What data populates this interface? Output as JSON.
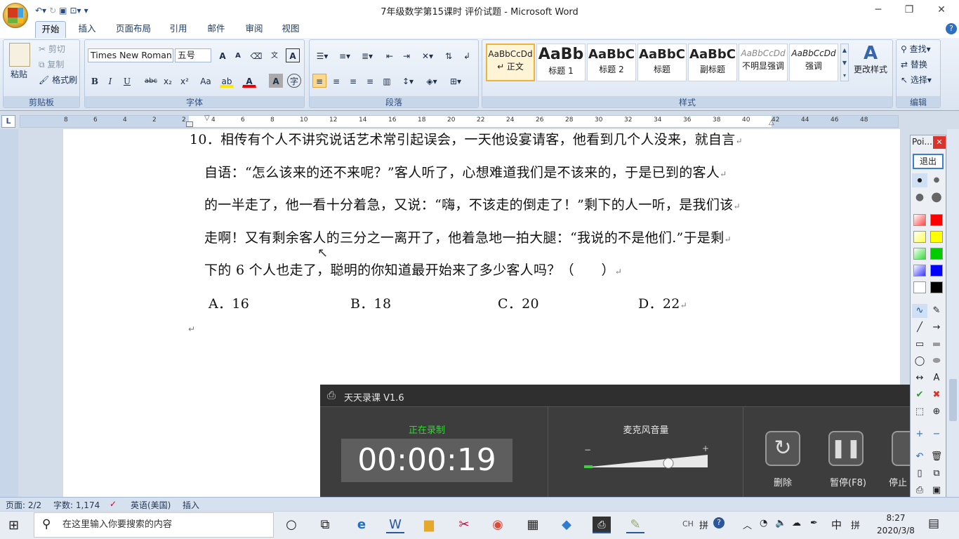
{
  "window": {
    "title": "7年级数学第15课时 评价试题 - Microsoft Word"
  },
  "tabs": [
    "开始",
    "插入",
    "页面布局",
    "引用",
    "邮件",
    "审阅",
    "视图"
  ],
  "clipboard": {
    "paste": "粘贴",
    "cut": "剪切",
    "copy": "复制",
    "format_painter": "格式刷",
    "group": "剪贴板"
  },
  "font": {
    "name": "Times New Roman",
    "size": "五号",
    "group": "字体",
    "grow": "A",
    "shrink": "A",
    "bold": "B",
    "italic": "I",
    "underline": "U",
    "strike": "abc",
    "subscript": "x₂",
    "superscript": "x²",
    "change_case": "Aa"
  },
  "paragraph": {
    "group": "段落"
  },
  "styles": {
    "group": "样式",
    "items": [
      {
        "sample": "AaBbCcDd",
        "name": "↵ 正文"
      },
      {
        "sample": "AaBb",
        "name": "标题 1"
      },
      {
        "sample": "AaBbC",
        "name": "标题 2"
      },
      {
        "sample": "AaBbC",
        "name": "标题"
      },
      {
        "sample": "AaBbC",
        "name": "副标题"
      },
      {
        "sample": "AaBbCcDd",
        "name": "不明显强调"
      },
      {
        "sample": "AaBbCcDd",
        "name": "强调"
      }
    ],
    "change_styles": "更改样式"
  },
  "editing": {
    "group": "编辑",
    "find": "查找",
    "replace": "替换",
    "select": "选择"
  },
  "ruler_numbers": [
    "8",
    "6",
    "4",
    "2",
    "2",
    "4",
    "6",
    "8",
    "10",
    "12",
    "14",
    "16",
    "18",
    "20",
    "22",
    "24",
    "26",
    "28",
    "30",
    "32",
    "34",
    "36",
    "38",
    "40",
    "42",
    "44",
    "46",
    "48"
  ],
  "document": {
    "lines": [
      "10．相传有个人不讲究说话艺术常引起误会，一天他设宴请客，他看到几个人没来，就自言",
      "自语：“怎么该来的还不来呢？”客人听了，心想难道我们是不该来的，于是已到的客人",
      "的一半走了，他一看十分着急，又说：“嗨，不该走的倒走了！”剩下的人一听，是我们该",
      "走啊！又有剩余客人的三分之一离开了，他着急地一拍大腿：“我说的不是他们.”于是剩",
      "下的 6 个人也走了，聪明的你知道最开始来了多少客人吗？（　　）"
    ],
    "options": [
      "A．16",
      "B．18",
      "C．20",
      "D．22"
    ]
  },
  "statusbar": {
    "page": "页面: 2/2",
    "words": "字数: 1,174",
    "language": "英语(美国)",
    "mode": "插入"
  },
  "recorder": {
    "title": "天天录课 V1.6",
    "status": "正在录制",
    "timer": "00:00:19",
    "mic_label": "麦克风音量",
    "mic_minus": "−",
    "mic_plus": "+",
    "mic_level": 0.7,
    "delete": "删除",
    "pause": "暂停(F8)",
    "stop": "停止"
  },
  "pointofix": {
    "title": "Poi...",
    "exit": "退出"
  },
  "taskbar": {
    "search_placeholder": "在这里输入你要搜索的内容",
    "ime1": "拼",
    "ime2": "中",
    "ime3": "拼",
    "time": "8:27",
    "date": "2020/3/8"
  },
  "colors": {
    "accent": "#2b579a",
    "recording": "#3ecf3e",
    "ribbon": "#dae4f1"
  }
}
